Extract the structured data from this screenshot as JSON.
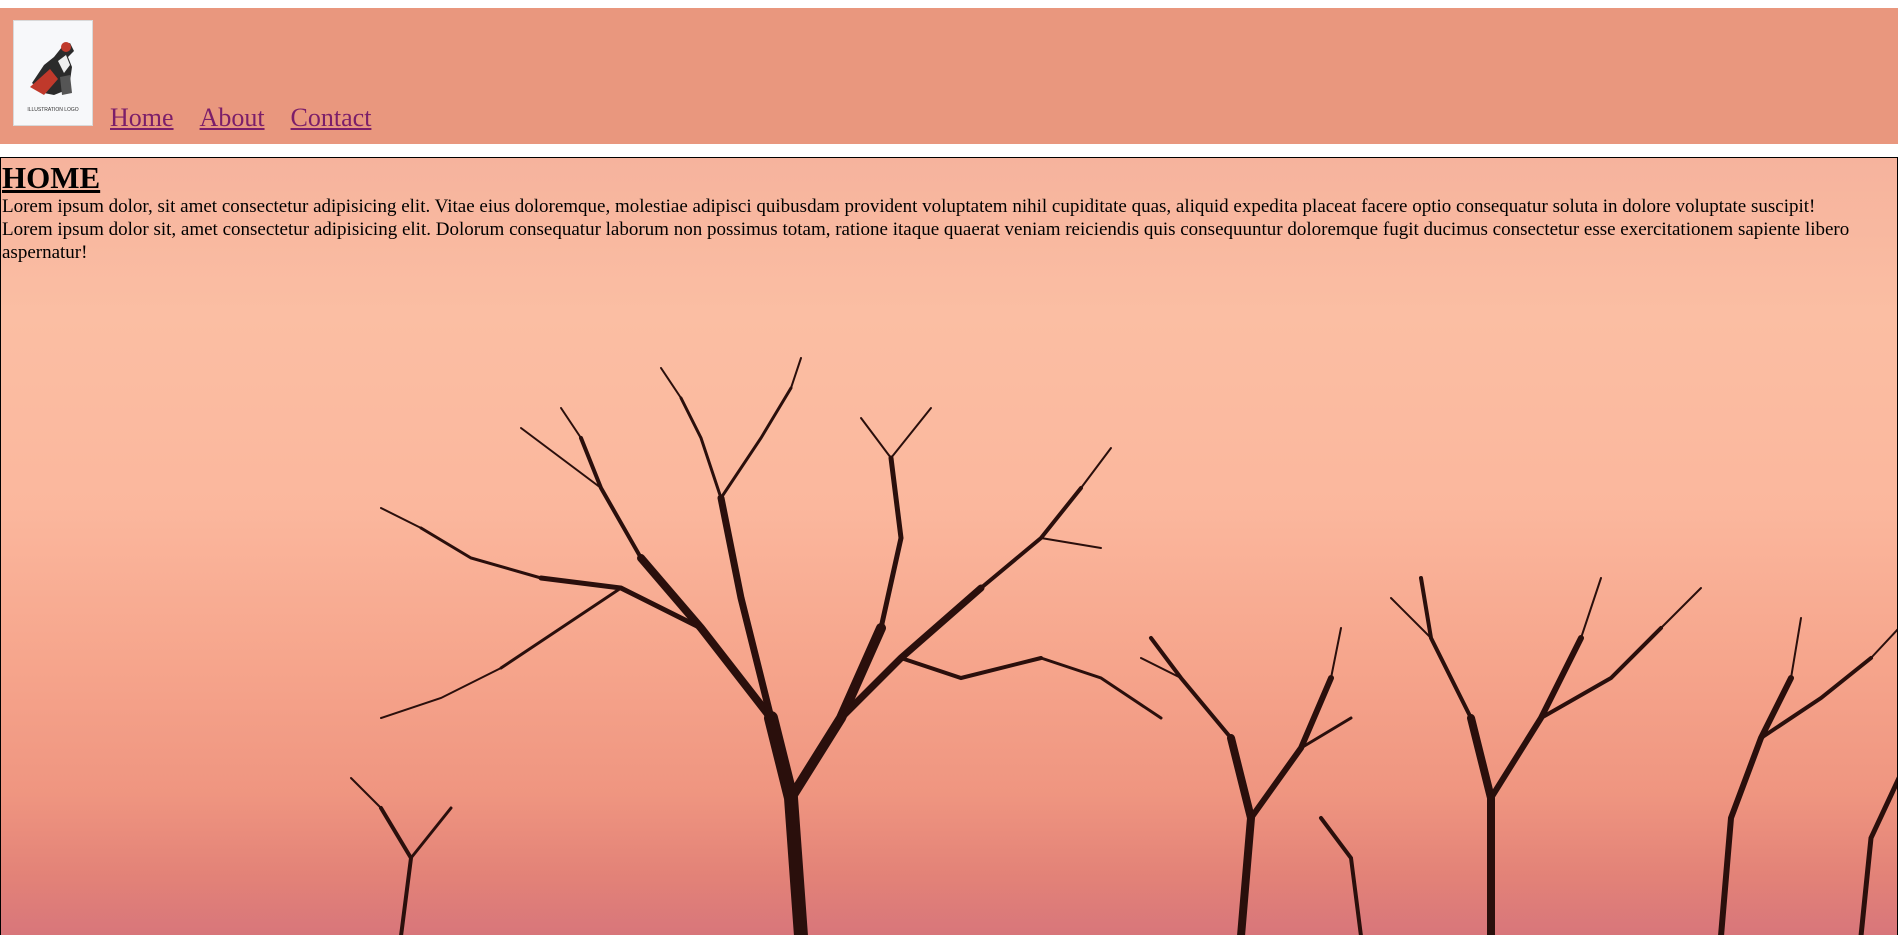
{
  "logo": {
    "caption": "ILLUSTRATION LOGO"
  },
  "nav": {
    "items": [
      {
        "label": "Home"
      },
      {
        "label": "About"
      },
      {
        "label": "Contact"
      }
    ]
  },
  "main": {
    "heading": "HOME",
    "paragraphs": [
      "Lorem ipsum dolor, sit amet consectetur adipisicing elit. Vitae eius doloremque, molestiae adipisci quibusdam provident voluptatem nihil cupiditate quas, aliquid expedita placeat facere optio consequatur soluta in dolore voluptate suscipit!",
      "Lorem ipsum dolor sit, amet consectetur adipisicing elit. Dolorum consequatur laborum non possimus totam, ratione itaque quaerat veniam reiciendis quis consequuntur doloremque fugit ducimus consectetur esse exercitationem sapiente libero aspernatur!"
    ]
  },
  "colors": {
    "header_bg": "#e9977e",
    "link": "#7b1e6a",
    "sky_top": "#f6b39d",
    "sky_bottom": "#d8767a",
    "tree": "#2a0f0c"
  }
}
